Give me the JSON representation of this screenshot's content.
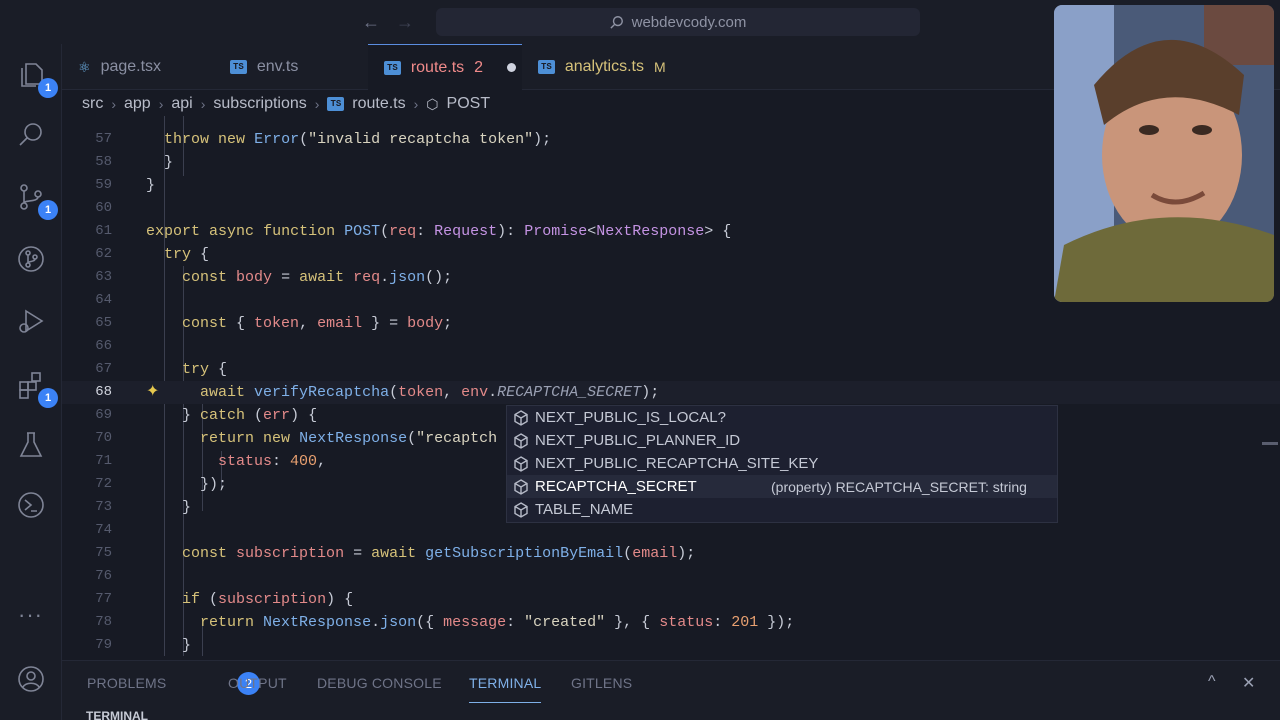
{
  "titlebar": {
    "search": "webdevcody.com",
    "back_arrow": "←",
    "forward_arrow": "→"
  },
  "activity": {
    "explorer_badge": "1",
    "source_control_badge": "1",
    "extensions_badge": "1",
    "more": "···"
  },
  "tabs": [
    {
      "label": "page.tsx",
      "icon": "react-icon"
    },
    {
      "label": "env.ts",
      "icon": "ts-icon",
      "badge": "TS"
    },
    {
      "label": "route.ts",
      "icon": "ts-icon",
      "badge": "TS",
      "problems": "2"
    },
    {
      "label": "analytics.ts",
      "icon": "ts-icon",
      "badge": "TS",
      "status": "M"
    }
  ],
  "breadcrumb": [
    "src",
    "app",
    "api",
    "subscriptions",
    "route.ts",
    "POST"
  ],
  "editor": {
    "lines": [
      {
        "n": "57"
      },
      {
        "n": "58"
      },
      {
        "n": "59"
      },
      {
        "n": "60"
      },
      {
        "n": "61"
      },
      {
        "n": "62"
      },
      {
        "n": "63"
      },
      {
        "n": "64"
      },
      {
        "n": "65"
      },
      {
        "n": "66"
      },
      {
        "n": "67"
      },
      {
        "n": "68"
      },
      {
        "n": "69"
      },
      {
        "n": "70"
      },
      {
        "n": "71"
      },
      {
        "n": "72"
      },
      {
        "n": "73"
      },
      {
        "n": "74"
      },
      {
        "n": "75"
      },
      {
        "n": "76"
      },
      {
        "n": "77"
      },
      {
        "n": "78"
      },
      {
        "n": "79"
      }
    ]
  },
  "suggestions": {
    "items": [
      "NEXT_PUBLIC_IS_LOCAL?",
      "NEXT_PUBLIC_PLANNER_ID",
      "NEXT_PUBLIC_RECAPTCHA_SITE_KEY",
      "RECAPTCHA_SECRET",
      "TABLE_NAME"
    ],
    "detail": "(property) RECAPTCHA_SECRET: string"
  },
  "panel": {
    "tabs": [
      "PROBLEMS",
      "OUTPUT",
      "DEBUG CONSOLE",
      "TERMINAL",
      "GITLENS"
    ],
    "problems_count": "2",
    "terminal_title": "TERMINAL",
    "maximize_icon": "^",
    "close_icon": "✕"
  },
  "colors": {
    "accent": "#3b82f6",
    "background": "#171a24",
    "keyword": "#d6c27a",
    "function": "#7fb0e8"
  }
}
